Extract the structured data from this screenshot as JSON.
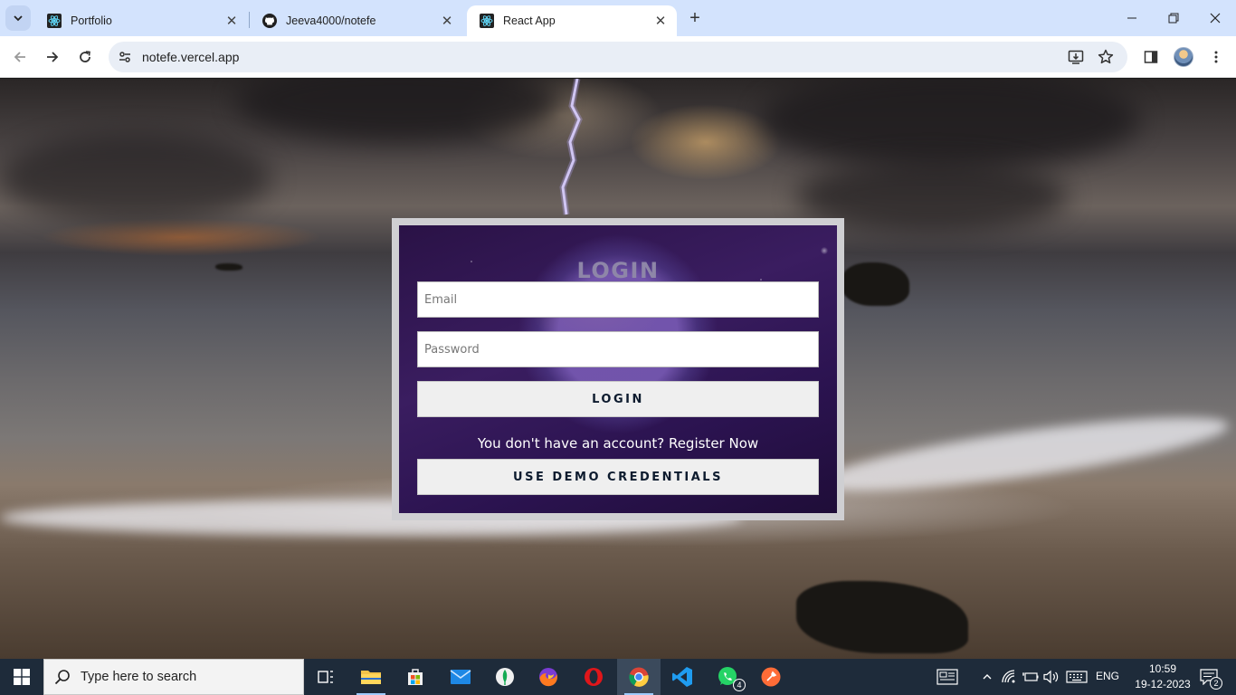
{
  "browser": {
    "tabs": [
      {
        "title": "Portfolio",
        "favicon": "react-icon"
      },
      {
        "title": "Jeeva4000/notefe",
        "favicon": "github-icon"
      },
      {
        "title": "React App",
        "favicon": "react-icon",
        "active": true
      }
    ],
    "url": "notefe.vercel.app"
  },
  "login": {
    "title": "LOGIN",
    "email_placeholder": "Email",
    "password_placeholder": "Password",
    "login_button": "LOGIN",
    "register_text": "You don't have an account? Register Now",
    "demo_button": "USE DEMO CREDENTIALS"
  },
  "taskbar": {
    "search_placeholder": "Type here to search",
    "apps": [
      "task-view",
      "file-explorer",
      "microsoft-store",
      "mail",
      "mongodb-compass",
      "firefox",
      "opera",
      "chrome",
      "vscode",
      "whatsapp",
      "postman"
    ],
    "whatsapp_badge": "4",
    "language": "ENG",
    "time": "10:59",
    "date": "19-12-2023",
    "notifications": "2"
  },
  "colors": {
    "tabbar_bg": "#d3e3fd",
    "card_border": "#cfcfd2",
    "card_bg": "#2a1246",
    "title_color": "#8e86a8",
    "taskbar_bg": "#1e2b3a"
  }
}
